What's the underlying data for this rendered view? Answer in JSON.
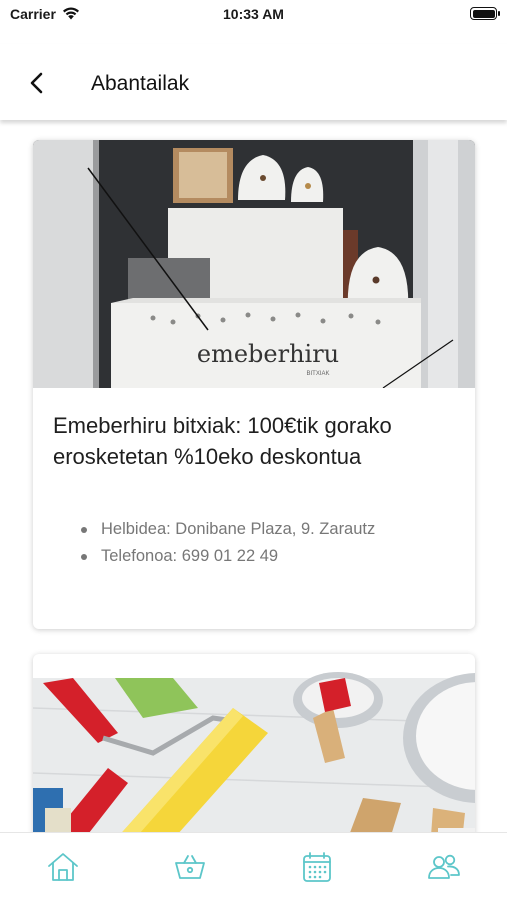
{
  "status_bar": {
    "carrier": "Carrier",
    "time": "10:33 AM",
    "battery_level": 1.0
  },
  "header": {
    "title": "Abantailak"
  },
  "offers": [
    {
      "title": "Emeberhiru bitxiak: 100€tik gorako erosketetan %10eko deskontua",
      "details": [
        "Helbidea: Donibane Plaza, 9. Zarautz",
        "Telefonoa: 699 01 22 49"
      ],
      "logo_text": "emeberhiru",
      "logo_sub": "BITXIAK"
    },
    {
      "image": "paint-tools-photo"
    }
  ],
  "tab_bar": {
    "accent_color": "#5cc6c9",
    "items": [
      {
        "icon": "home-icon"
      },
      {
        "icon": "basket-icon"
      },
      {
        "icon": "calendar-icon"
      },
      {
        "icon": "users-icon"
      }
    ]
  }
}
